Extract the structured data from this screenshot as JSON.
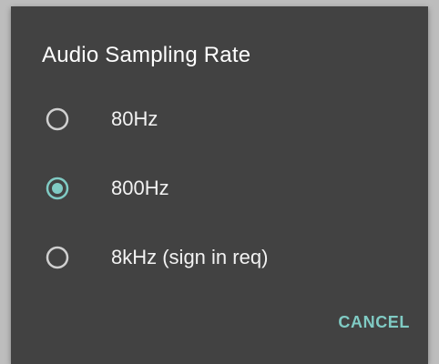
{
  "dialog": {
    "title": "Audio Sampling Rate",
    "options": [
      {
        "label": "80Hz",
        "selected": false
      },
      {
        "label": "800Hz",
        "selected": true
      },
      {
        "label": "8kHz (sign in req)",
        "selected": false
      }
    ],
    "cancel_label": "CANCEL"
  },
  "colors": {
    "dialog_bg": "#424242",
    "accent": "#80cbc4",
    "radio_unselected": "#d0d0d0",
    "text": "#f2f2f2"
  }
}
